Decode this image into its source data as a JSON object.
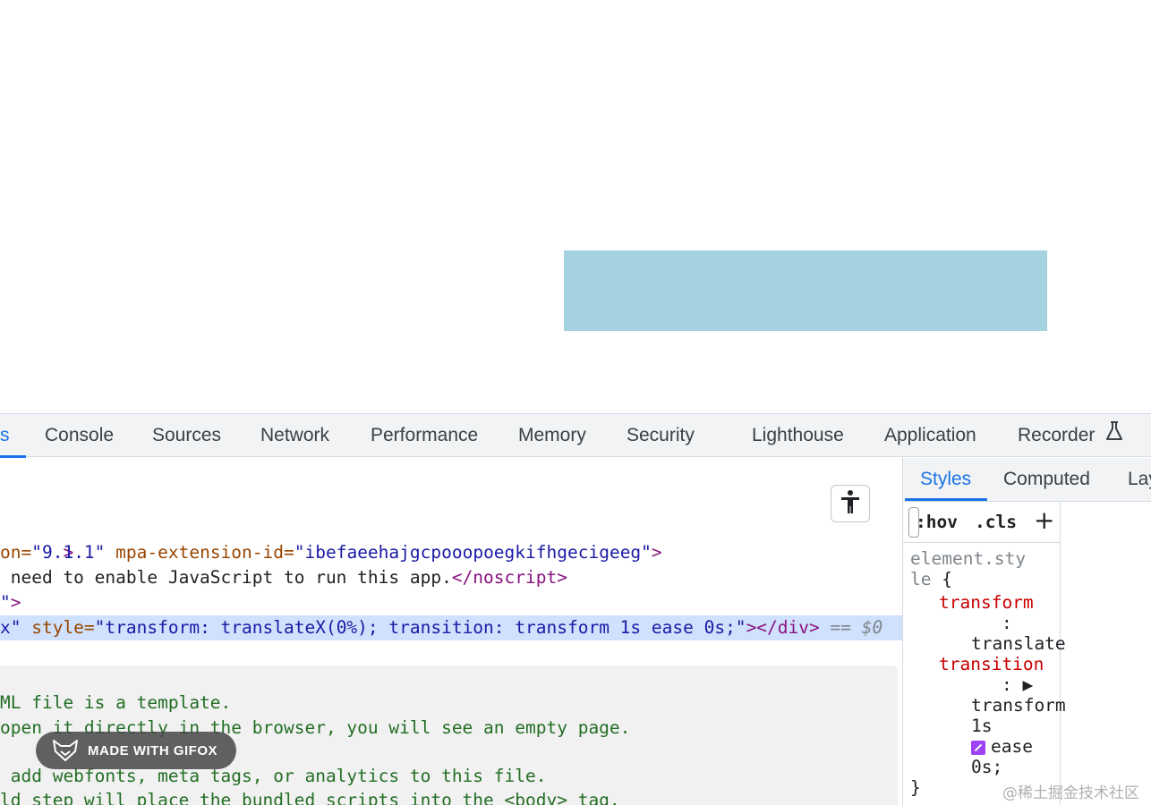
{
  "colors": {
    "demo_box": "#a6d1e0",
    "accent": "#1a73e8",
    "selected_row": "#cfe1fc"
  },
  "devtools": {
    "tabs": [
      {
        "label": "s",
        "active": true
      },
      {
        "label": "Console"
      },
      {
        "label": "Sources"
      },
      {
        "label": "Network"
      },
      {
        "label": "Performance"
      },
      {
        "label": "Memory"
      },
      {
        "label": "Security"
      },
      {
        "label": "Lighthouse"
      },
      {
        "label": "Application"
      },
      {
        "label": "Recorder"
      }
    ],
    "elements": {
      "line1": ">",
      "line2": {
        "attr1": "on=",
        "val1": "\"9.1.1\"",
        "attr2": " mpa-extension-id=",
        "val2": "\"ibefaeehajgcpooopoegkifhgecigeeg\"",
        "close": ">"
      },
      "line3": {
        "text": " need to enable JavaScript to run this app.",
        "close": "</noscript>"
      },
      "line4": {
        "val": "\"",
        "close": ">"
      },
      "selected": {
        "val1": "x\"",
        "attr": " style=",
        "val2": "\"transform: translateX(0%); transition: transform 1s ease 0s;\"",
        "close": "></div>",
        "marker": " == $0"
      },
      "comment": [
        "ML file is a template.",
        "open it directly in the browser, you will see an empty page.",
        "",
        " add webfonts, meta tags, or analytics to this file.",
        "ld step will place the bundled scripts into the <body> tag."
      ]
    },
    "sidebar": {
      "tabs": [
        {
          "label": "Styles",
          "active": true
        },
        {
          "label": "Computed"
        },
        {
          "label": "Lay"
        }
      ],
      "filter": {
        "hov": ":hov",
        "cls": ".cls",
        "add": "+"
      },
      "rule": {
        "selector_a": "element.sty",
        "selector_b": "le",
        "brace_open": " {",
        "prop1": "transform",
        "val1": "translate",
        "prop2": "transition",
        "val2a": "transform",
        "val2b": "1s",
        "val2c": "ease",
        "val2d": "0s;",
        "brace_close": "}"
      }
    }
  },
  "overlay": {
    "gifox": "MADE WITH GIFOX",
    "watermark": "@稀土掘金技术社区"
  }
}
